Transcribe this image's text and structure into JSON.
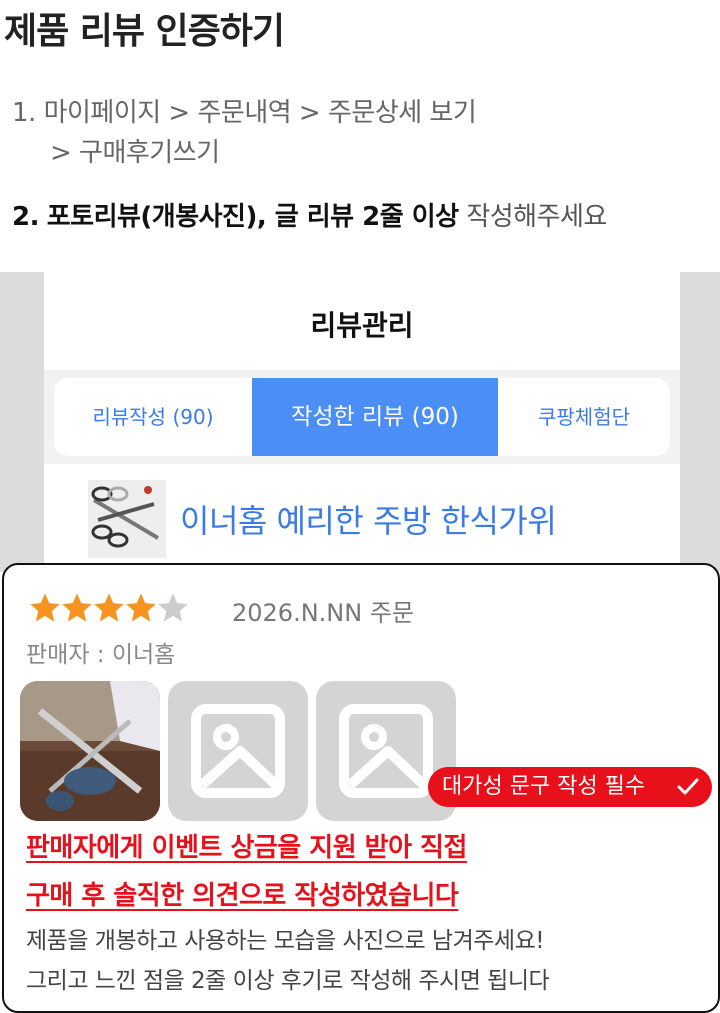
{
  "title": "제품 리뷰 인증하기",
  "steps": {
    "step1_line1": "1. 마이페이지 > 주문내역 > 주문상세 보기",
    "step1_line2": "> 구매후기쓰기",
    "step2_prefix": "2.",
    "step2_bold": "포토리뷰(개봉사진), 글 리뷰 2줄 이상",
    "step2_light": "작성해주세요"
  },
  "review_manager": {
    "title": "리뷰관리",
    "tabs": [
      {
        "label": "리뷰작성 (90)",
        "active": false
      },
      {
        "label": "작성한 리뷰 (90)",
        "active": true
      },
      {
        "label": "쿠팡체험단",
        "active": false
      }
    ],
    "product_name": "이너홈 예리한 주방 한식가위"
  },
  "review_card": {
    "rating": 4,
    "max_rating": 5,
    "order_date": "2026.N.NN 주문",
    "seller": "판매자 : 이너홈",
    "badge": "대가성 문구 작성 필수",
    "disclosure_line1": "판매자에게 이벤트 상금을 지원 받아 직접",
    "disclosure_line2": "구매 후 솔직한 의견으로 작성하였습니다",
    "note_line1": "제품을 개봉하고 사용하는 모습을 사진으로 남겨주세요!",
    "note_line2": "그리고 느낀 점을 2줄 이상 후기로 작성해 주시면 됩니다"
  },
  "colors": {
    "accent_blue": "#4b8ef5",
    "link_blue": "#3a7be8",
    "star_orange": "#f7931e",
    "star_gray": "#cccccc",
    "warning_red": "#e8101a"
  },
  "icons": [
    "star-icon",
    "image-placeholder-icon",
    "checkmark-icon"
  ]
}
